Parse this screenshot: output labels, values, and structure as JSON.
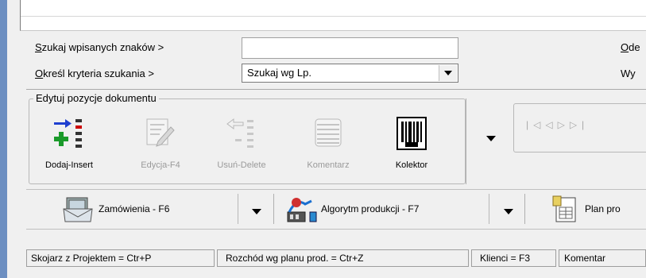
{
  "search": {
    "label_accel": "S",
    "label_rest": "zukaj wpisanych znaków >",
    "value": "",
    "criteria_accel": "O",
    "criteria_rest": "kreśl kryteria szukania >",
    "criteria_value": "Szukaj wg Lp.",
    "right_label_1": "Ode",
    "right_label_1_accel": "O",
    "right_label_1_rest": "de",
    "right_label_2": "Wy"
  },
  "edit_group": {
    "title": "Edytuj pozycje dokumentu",
    "tools": [
      {
        "label": "Dodaj-Insert",
        "icon": "add-insert-icon",
        "enabled": true
      },
      {
        "label": "Edycja-F4",
        "icon": "edit-icon",
        "enabled": false
      },
      {
        "label": "Usuń-Delete",
        "icon": "delete-icon",
        "enabled": false
      },
      {
        "label": "Komentarz",
        "icon": "comment-icon",
        "enabled": false
      },
      {
        "label": "Kolektor",
        "icon": "barcode-icon",
        "enabled": true
      }
    ]
  },
  "navigation": {
    "icons": [
      "first-icon",
      "prev-icon",
      "next-icon",
      "last-icon"
    ]
  },
  "actionbar": {
    "orders": "Zamówienia - F6",
    "algorithm": "Algorytm produkcji - F7",
    "plan": "Plan pro"
  },
  "statusbar": {
    "cells": [
      "Skojarz z Projektem = Ctr+P",
      "Rozchód wg planu prod. = Ctr+Z",
      "Klienci = F3",
      "Komentar"
    ]
  },
  "colors": {
    "window_bg": "#f0f0f0",
    "left_accent": "#6d8fc1",
    "disabled_text": "#9a9a9a"
  }
}
